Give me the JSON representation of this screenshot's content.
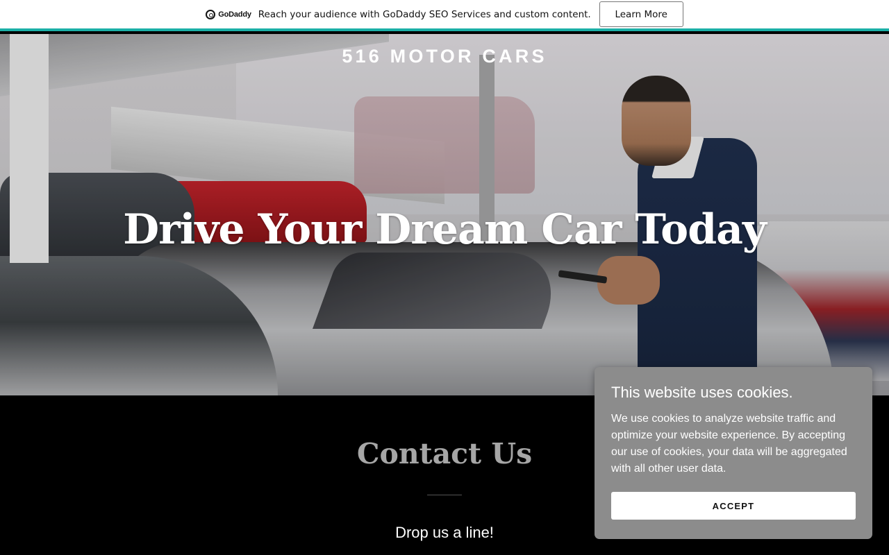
{
  "promo": {
    "brand": "GoDaddy",
    "message": "Reach your audience with GoDaddy SEO Services and custom content.",
    "cta_label": "Learn More",
    "accent_color": "#1bb0a7"
  },
  "header": {
    "site_name": "516 MOTOR CARS"
  },
  "hero": {
    "title": "Drive Your Dream Car Today"
  },
  "contact": {
    "title": "Contact Us",
    "subtitle": "Drop us a line!"
  },
  "cookie_banner": {
    "title": "This website uses cookies.",
    "body": "We use cookies to analyze website traffic and optimize your website experience. By accepting our use of cookies, your data will be aggregated with all other user data.",
    "accept_label": "ACCEPT"
  }
}
